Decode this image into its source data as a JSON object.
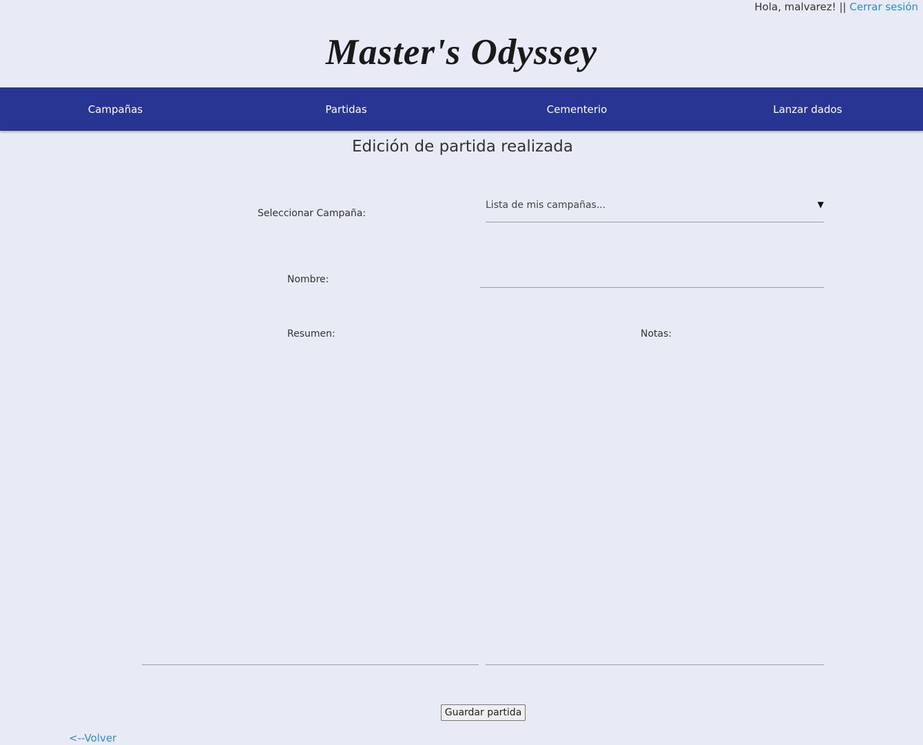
{
  "header": {
    "greeting": "Hola, malvarez! ||",
    "logout_label": "Cerrar sesión",
    "logo_text": "Master's Odyssey"
  },
  "nav": {
    "items": [
      {
        "label": "Campañas"
      },
      {
        "label": "Partidas"
      },
      {
        "label": "Cementerio"
      },
      {
        "label": "Lanzar dados"
      }
    ]
  },
  "main": {
    "title": "Edición de partida realizada",
    "campaign_label": "Seleccionar Campaña:",
    "campaign_select_value": "Lista de mis campañas...",
    "name_label": "Nombre:",
    "name_value": "",
    "summary_label": "Resumen:",
    "notes_label": "Notas:",
    "save_label": "Guardar partida",
    "back_label": "<--Volver"
  },
  "colors": {
    "background": "#e8eaf6",
    "navbar": "#283593",
    "link": "#2b8ed1"
  },
  "icons": {
    "select_arrow": "dropdown-triangle"
  }
}
